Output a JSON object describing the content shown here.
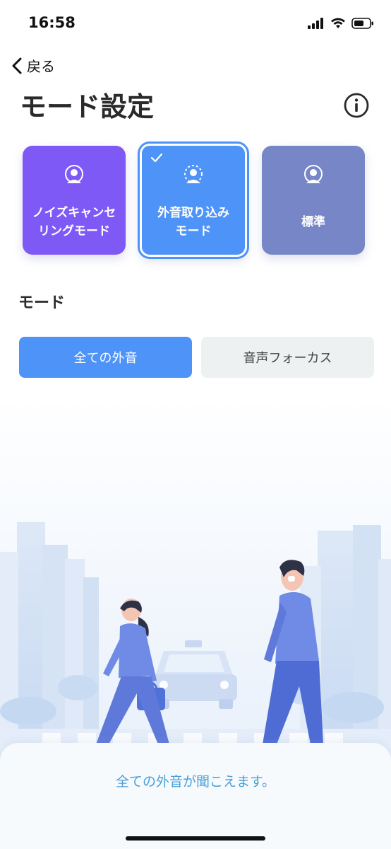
{
  "status": {
    "time": "16:58"
  },
  "nav": {
    "back_label": "戻る"
  },
  "header": {
    "title": "モード設定"
  },
  "modes": [
    {
      "label": "ノイズキャンセリングモード",
      "line1": "ノイズキャンセ",
      "line2": "リングモード",
      "color": "#7e59f6"
    },
    {
      "label": "外音取り込みモード",
      "line1": "外音取り込み",
      "line2": "モード",
      "color": "#4e93f7",
      "selected": true
    },
    {
      "label": "標準",
      "line1": "標準",
      "line2": "",
      "color": "#7686c7"
    }
  ],
  "section": {
    "title": "モード"
  },
  "segments": [
    {
      "label": "全ての外音",
      "selected": true
    },
    {
      "label": "音声フォーカス",
      "selected": false
    }
  ],
  "description": "全ての外音が聞こえます。",
  "colors": {
    "accent": "#4e93f7",
    "description_text": "#4aa0d8"
  }
}
